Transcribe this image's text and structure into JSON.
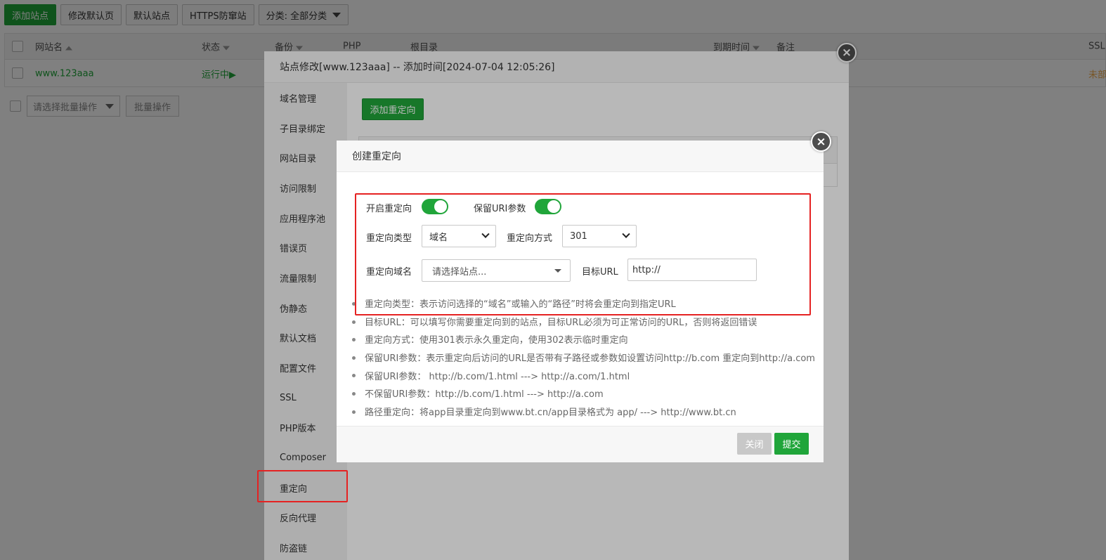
{
  "toolbar": {
    "add_site": "添加站点",
    "edit_default_page": "修改默认页",
    "default_site": "默认站点",
    "https_guard": "HTTPS防窜站",
    "category": "分类: 全部分类"
  },
  "site_table": {
    "headers": {
      "name": "网站名",
      "status": "状态",
      "backup": "备份",
      "php": "PHP",
      "root": "根目录",
      "expire": "到期时间",
      "note": "备注",
      "ssl": "SSL"
    },
    "row": {
      "name": "www.123aaa",
      "status": "运行中",
      "status_icon": "▶",
      "ssl": "未部"
    }
  },
  "batch": {
    "select_placeholder": "请选择批量操作",
    "button": "批量操作"
  },
  "outer_dialog": {
    "title": "站点修改[www.123aaa] -- 添加时间[2024-07-04 12:05:26]",
    "close": "×",
    "sidebar": [
      "域名管理",
      "子目录绑定",
      "网站目录",
      "访问限制",
      "应用程序池",
      "错误页",
      "流量限制",
      "伪静态",
      "默认文档",
      "配置文件",
      "SSL",
      "PHP版本",
      "Composer",
      "重定向",
      "反向代理",
      "防盗链"
    ],
    "add_redirect": "添加重定向"
  },
  "dialog": {
    "title": "创建重定向",
    "close": "×",
    "enable_redirect_label": "开启重定向",
    "keep_uri_label": "保留URI参数",
    "enable_redirect": true,
    "keep_uri": true,
    "redirect_type_label": "重定向类型",
    "redirect_type_value": "域名",
    "redirect_method_label": "重定向方式",
    "redirect_method_value": "301",
    "redirect_domain_label": "重定向域名",
    "redirect_domain_placeholder": "请选择站点...",
    "target_url_label": "目标URL",
    "target_url_value": "http://",
    "tips": [
      "重定向类型：表示访问选择的“域名”或输入的“路径”时将会重定向到指定URL",
      "目标URL：可以填写你需要重定向到的站点，目标URL必须为可正常访问的URL，否则将返回错误",
      "重定向方式：使用301表示永久重定向，使用302表示临时重定向",
      "保留URI参数：表示重定向后访问的URL是否带有子路径或参数如设置访问http://b.com 重定向到http://a.com",
      "保留URI参数：  http://b.com/1.html ---> http://a.com/1.html",
      "不保留URI参数：http://b.com/1.html ---> http://a.com",
      "路径重定向：将app目录重定向到www.bt.cn/app目录格式为 app/ ---> http://www.bt.cn"
    ],
    "close_button": "关闭",
    "submit_button": "提交"
  },
  "colors": {
    "brand_green": "#20a53a",
    "highlight_red": "#e52222"
  }
}
